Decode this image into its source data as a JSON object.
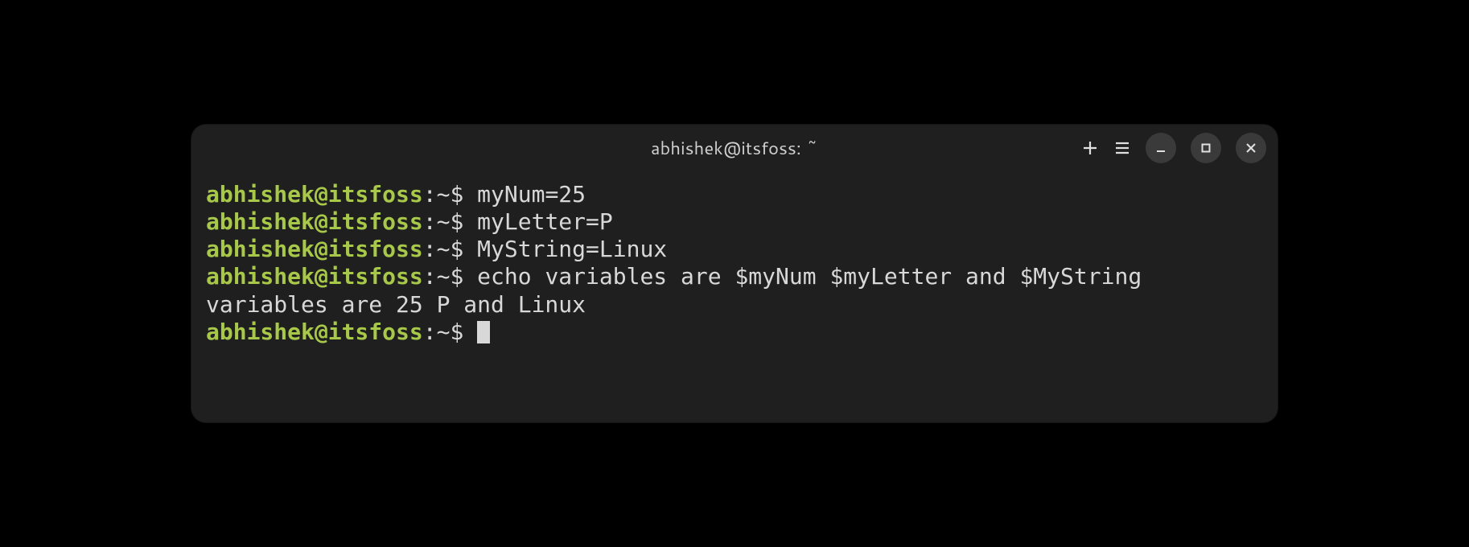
{
  "window": {
    "title": "abhishek@itsfoss: ~"
  },
  "prompt": {
    "user_host": "abhishek@itsfoss",
    "separator": ":",
    "path": "~",
    "symbol": "$"
  },
  "lines": [
    {
      "type": "cmd",
      "command": "myNum=25"
    },
    {
      "type": "cmd",
      "command": "myLetter=P"
    },
    {
      "type": "cmd",
      "command": "MyString=Linux"
    },
    {
      "type": "cmd",
      "command": "echo variables are $myNum $myLetter and $MyString"
    },
    {
      "type": "output",
      "text": "variables are 25 P and Linux"
    },
    {
      "type": "cmd",
      "command": "",
      "cursor": true
    }
  ]
}
